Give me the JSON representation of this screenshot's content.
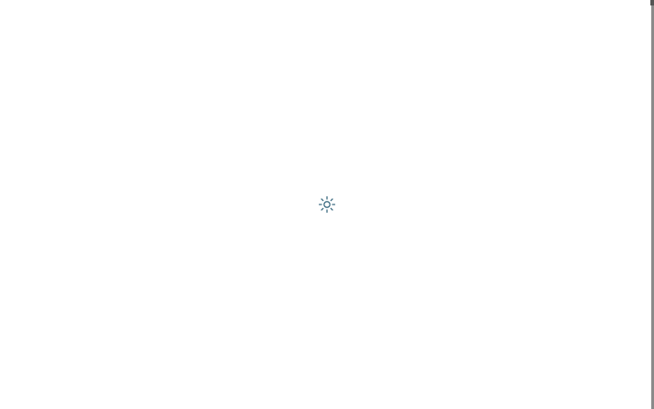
{
  "page": {
    "state": "loading",
    "background_color": "#ffffff"
  },
  "spinner": {
    "icon": "loading-spinner-icon",
    "color": "#3b6a80"
  },
  "scrollbar": {
    "thumb_color": "#8a8a8a"
  }
}
